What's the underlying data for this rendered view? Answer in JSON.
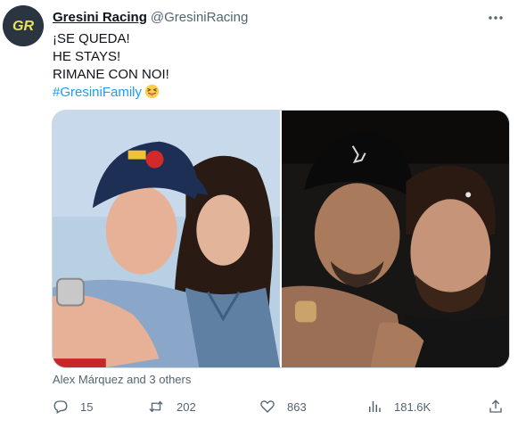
{
  "author": {
    "name": "Gresini Racing",
    "handle": "@GresiniRacing",
    "avatar_text": "GR"
  },
  "tweet": {
    "lines": [
      "¡SE QUEDA!",
      "HE STAYS!",
      "RIMANE CON NOI!"
    ],
    "hashtag": "#GresiniFamily",
    "emoji": "squinting-face-with-tongue"
  },
  "media": {
    "photos": [
      {
        "icon": "photo-rider-and-woman"
      },
      {
        "icon": "photo-two-men-selfie"
      }
    ]
  },
  "tagged_text": "Alex Márquez and 3 others",
  "actions": {
    "replies": "15",
    "retweets": "202",
    "likes": "863",
    "views": "181.6K"
  },
  "colors": {
    "accent": "#1d9bf0",
    "muted": "#536471",
    "avatar_bg": "#2b3542",
    "avatar_logo": "#e8e35a"
  }
}
